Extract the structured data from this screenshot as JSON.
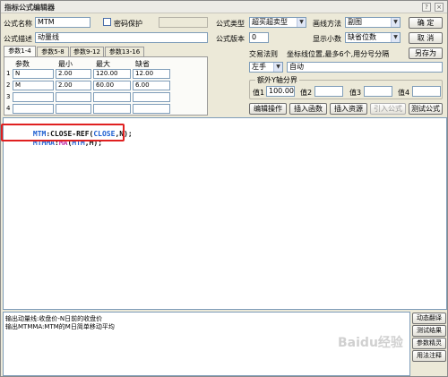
{
  "window": {
    "title": "指标公式编辑器",
    "help_glyph": "?",
    "close_glyph": "×"
  },
  "form": {
    "name_label": "公式名称",
    "name_value": "MTM",
    "password_label": "密码保护",
    "desc_label": "公式描述",
    "desc_value": "动量线",
    "type_label": "公式类型",
    "type_value": "超买超卖型",
    "draw_label": "画线方法",
    "draw_value": "副图",
    "version_label": "公式版本",
    "version_value": "0",
    "decimals_label": "显示小数",
    "decimals_value": "缺省位数",
    "trade_label": "交易法则",
    "coord_note": "坐标线位置,最多6个,用分号分隔",
    "trade_value": "左手",
    "coord_value": "自动",
    "yaxis_label": "额外Y轴分界",
    "values": [
      {
        "label": "值1",
        "value": "100.00"
      },
      {
        "label": "值2",
        "value": ""
      },
      {
        "label": "值3",
        "value": ""
      },
      {
        "label": "值4",
        "value": ""
      }
    ]
  },
  "buttons": {
    "ok": "确  定",
    "cancel": "取  消",
    "save_as": "另存为",
    "edit_op": "编辑操作",
    "insert_func": "插入函数",
    "insert_res": "插入资源",
    "import_formula": "引入公式",
    "test_formula": "测试公式"
  },
  "tabs": [
    "参数1-4",
    "参数5-8",
    "参数9-12",
    "参数13-16"
  ],
  "params": {
    "headers": [
      "参数",
      "最小",
      "最大",
      "缺省"
    ],
    "rows": [
      {
        "num": "1",
        "name": "N",
        "min": "2.00",
        "max": "120.00",
        "default": "12.00"
      },
      {
        "num": "2",
        "name": "M",
        "min": "2.00",
        "max": "60.00",
        "default": "6.00"
      },
      {
        "num": "3",
        "name": "",
        "min": "",
        "max": "",
        "default": ""
      },
      {
        "num": "4",
        "name": "",
        "min": "",
        "max": "",
        "default": ""
      }
    ]
  },
  "code": {
    "line1": [
      {
        "text": "MTM",
        "color": "#1d5fd1"
      },
      {
        "text": ":CLOSE-REF(",
        "color": "#111111"
      },
      {
        "text": "CLOSE",
        "color": "#1d5fd1"
      },
      {
        "text": ",N);",
        "color": "#111111"
      }
    ],
    "line2": [
      {
        "text": "MTMMA",
        "color": "#1d5fd1"
      },
      {
        "text": ":",
        "color": "#111111"
      },
      {
        "text": "MA",
        "color": "#c02da8"
      },
      {
        "text": "(",
        "color": "#111111"
      },
      {
        "text": "MTM",
        "color": "#1d5fd1"
      },
      {
        "text": ",M);",
        "color": "#111111"
      }
    ]
  },
  "output": {
    "line1": "输出动量线:收盘价-N日前的收盘价",
    "line2": "输出MTMMA:MTM的M日简单移动平均"
  },
  "side_buttons": [
    "动态翻译",
    "测试结果",
    "参数精灵",
    "用法注释"
  ],
  "watermark": "Baidu经验"
}
